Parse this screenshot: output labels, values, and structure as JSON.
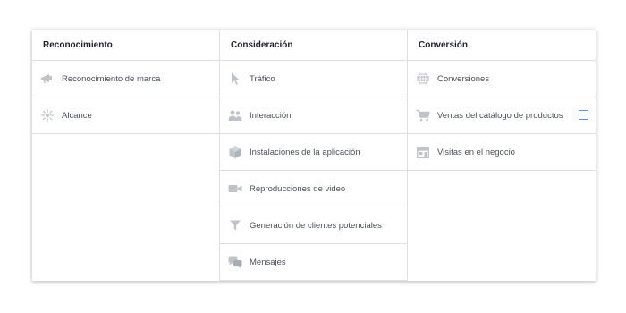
{
  "columns": [
    {
      "header": "Reconocimiento",
      "items": [
        {
          "label": "Reconocimiento de marca",
          "icon": "megaphone-icon"
        },
        {
          "label": "Alcance",
          "icon": "reach-icon"
        }
      ]
    },
    {
      "header": "Consideración",
      "items": [
        {
          "label": "Tráfico",
          "icon": "cursor-icon"
        },
        {
          "label": "Interacción",
          "icon": "people-icon"
        },
        {
          "label": "Instalaciones de la aplicación",
          "icon": "box-icon"
        },
        {
          "label": "Reproducciones de video",
          "icon": "video-camera-icon"
        },
        {
          "label": "Generación de clientes potenciales",
          "icon": "filter-icon"
        },
        {
          "label": "Mensajes",
          "icon": "chat-bubbles-icon"
        }
      ]
    },
    {
      "header": "Conversión",
      "items": [
        {
          "label": "Conversiones",
          "icon": "globe-icon"
        },
        {
          "label": "Ventas del catálogo de productos",
          "icon": "shopping-cart-icon",
          "checkbox": false
        },
        {
          "label": "Visitas en el negocio",
          "icon": "store-icon"
        }
      ]
    }
  ],
  "colors": {
    "icon": "#bec3c9",
    "checkbox_border": "#5b8ef0",
    "divider": "#dddfe2"
  }
}
